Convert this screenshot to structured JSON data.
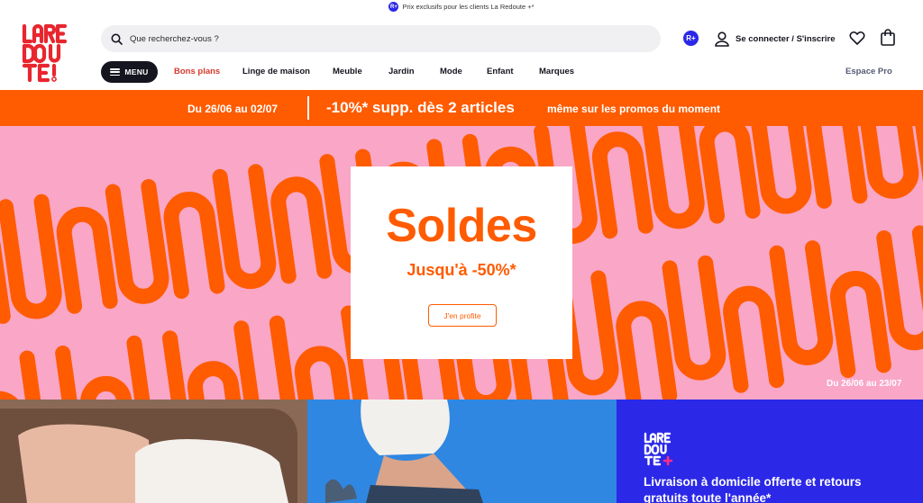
{
  "topbar": {
    "badge": "R+",
    "text": "Prix exclusifs pour les clients La Redoute +*"
  },
  "header": {
    "logo_text": "LA REDOUTE",
    "search_placeholder": "Que recherchez-vous ?",
    "rplus_badge": "R+",
    "login_label": "Se connecter / S'inscrire"
  },
  "nav": {
    "menu_label": "MENU",
    "items": [
      "Bons plans",
      "Linge de maison",
      "Meuble",
      "Jardin",
      "Mode",
      "Enfant",
      "Marques"
    ],
    "espace_pro": "Espace Pro"
  },
  "promo_strip": {
    "date": "Du 26/06 au 02/07",
    "headline": "-10%* supp. dès 2 articles",
    "subline": "même sur les promos du moment"
  },
  "hero": {
    "title": "Soldes",
    "subtitle": "Jusqu'à -50%*",
    "cta": "J'en profite",
    "date": "Du 26/06 au 23/07"
  },
  "tiles": {
    "laredoute_plus_text": "Livraison à domicile offerte et retours gratuits toute l'année*"
  },
  "colors": {
    "brand_red": "#e8262f",
    "orange": "#ff5b00",
    "pink": "#f9a6c7",
    "blue": "#2b28e8",
    "dark": "#14151e"
  },
  "icons": [
    "search-icon",
    "user-icon",
    "heart-icon",
    "bag-icon",
    "menu-icon"
  ]
}
